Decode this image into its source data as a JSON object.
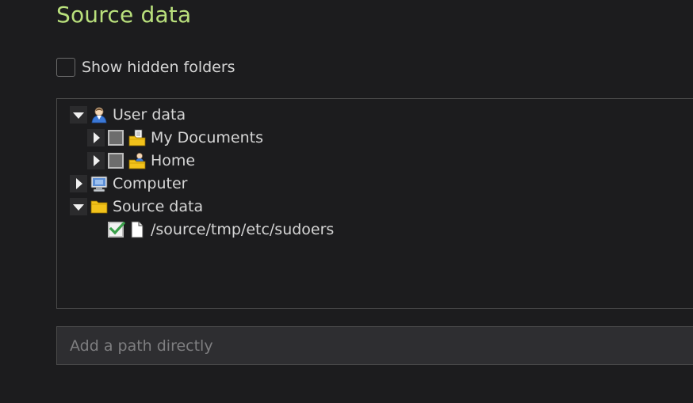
{
  "section": {
    "title": "Source data",
    "accent_color": "#b9e07c"
  },
  "options": {
    "show_hidden_label": "Show hidden folders",
    "show_hidden_checked": false
  },
  "tree": {
    "nodes": [
      {
        "label": "User data",
        "icon": "user-folder-icon",
        "expanded": true
      },
      {
        "label": "My Documents",
        "icon": "documents-folder-icon",
        "expanded": false,
        "checked": false
      },
      {
        "label": "Home",
        "icon": "home-folder-icon",
        "expanded": false,
        "checked": false
      },
      {
        "label": "Computer",
        "icon": "computer-icon",
        "expanded": false
      },
      {
        "label": "Source data",
        "icon": "folder-icon",
        "expanded": true
      },
      {
        "label": "/source/tmp/etc/sudoers",
        "icon": "file-icon",
        "checked": true
      }
    ]
  },
  "path_input": {
    "placeholder": "Add a path directly",
    "value": ""
  }
}
